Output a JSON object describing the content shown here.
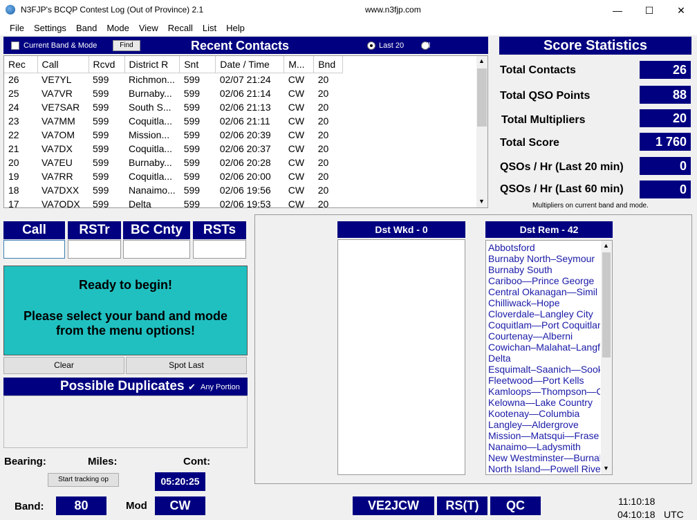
{
  "window": {
    "title": "N3FJP's BCQP Contest Log (Out of Province) 2.1",
    "url": "www.n3fjp.com",
    "minimize": "—",
    "maximize": "☐",
    "close": "✕"
  },
  "menu": [
    "File",
    "Settings",
    "Band",
    "Mode",
    "View",
    "Recall",
    "List",
    "Help"
  ],
  "recent_contacts": {
    "title": "Recent Contacts",
    "filter_label": "Current Band & Mode",
    "find_label": "Find",
    "radio_last20": "Last 20",
    "radio_all": "All",
    "columns": [
      "Rec",
      "Call",
      "Rcvd",
      "District R",
      "Snt",
      "Date / Time",
      "M...",
      "Bnd"
    ],
    "rows": [
      [
        "26",
        "VE7YL",
        "599",
        "Richmon...",
        "599",
        "02/07  21:24",
        "CW",
        "20"
      ],
      [
        "25",
        "VA7VR",
        "599",
        "Burnaby...",
        "599",
        "02/06  21:14",
        "CW",
        "20"
      ],
      [
        "24",
        "VE7SAR",
        "599",
        "South S...",
        "599",
        "02/06  21:13",
        "CW",
        "20"
      ],
      [
        "23",
        "VA7MM",
        "599",
        "Coquitla...",
        "599",
        "02/06  21:11",
        "CW",
        "20"
      ],
      [
        "22",
        "VA7OM",
        "599",
        "Mission...",
        "599",
        "02/06  20:39",
        "CW",
        "20"
      ],
      [
        "21",
        "VA7DX",
        "599",
        "Coquitla...",
        "599",
        "02/06  20:37",
        "CW",
        "20"
      ],
      [
        "20",
        "VA7EU",
        "599",
        "Burnaby...",
        "599",
        "02/06  20:28",
        "CW",
        "20"
      ],
      [
        "19",
        "VA7RR",
        "599",
        "Coquitla...",
        "599",
        "02/06  20:00",
        "CW",
        "20"
      ],
      [
        "18",
        "VA7DXX",
        "599",
        "Nanaimo...",
        "599",
        "02/06  19:56",
        "CW",
        "20"
      ],
      [
        "17",
        "VA7QDX",
        "599",
        "Delta",
        "599",
        "02/06  19:53",
        "CW",
        "20"
      ]
    ]
  },
  "score": {
    "title": "Score Statistics",
    "total_contacts_label": "Total Contacts",
    "total_contacts": "26",
    "total_qso_points_label": "Total QSO Points",
    "total_qso_points": "88",
    "total_multipliers_label": "Total Multipliers",
    "total_multipliers": "20",
    "total_score_label": "Total Score",
    "total_score": "1 760",
    "qso_hr20_label": "QSOs / Hr (Last 20 min)",
    "qso_hr20": "0",
    "qso_hr60_label": "QSOs / Hr (Last 60 min)",
    "qso_hr60": "0",
    "note": "Multipliers on current band and mode."
  },
  "entry": {
    "call_label": "Call",
    "rstr_label": "RSTr",
    "bccnty_label": "BC Cnty",
    "rsts_label": "RSTs"
  },
  "message": {
    "line1": "Ready to begin!",
    "line2": "Please select your band and mode",
    "line3": "from the menu options!"
  },
  "buttons": {
    "clear": "Clear",
    "spot_last": "Spot Last",
    "start_tracking": "Start tracking op"
  },
  "duplicates": {
    "title": "Possible Duplicates",
    "any_portion": "Any Portion"
  },
  "bottom": {
    "bearing_label": "Bearing:",
    "miles_label": "Miles:",
    "cont_label": "Cont:",
    "timer": "05:20:25",
    "band_label": "Band:",
    "band": "80",
    "mode_label": "Mod",
    "mode": "CW",
    "operator": "VE2JCW",
    "rst": "RS(T)",
    "province": "QC",
    "local_time": "11:10:18",
    "utc_time": "04:10:18",
    "utc_label": "UTC"
  },
  "districts": {
    "worked_header": "Dst Wkd - 0",
    "remaining_header": "Dst Rem - 42",
    "remaining": [
      "Abbotsford",
      "Burnaby North–Seymour",
      "Burnaby South",
      "Cariboo—Prince George",
      "Central Okanagan—Simil",
      "Chilliwack–Hope",
      "Cloverdale–Langley City",
      "Coquitlam—Port Coquitlan",
      "Courtenay—Alberni",
      "Cowichan–Malahat–Langf",
      "Delta",
      "Esquimalt–Saanich—Sook",
      "Fleetwood—Port Kells",
      "Kamloops—Thompson—C",
      "Kelowna—Lake Country",
      "Kootenay—Columbia",
      "Langley—Aldergrove",
      "Mission—Matsqui—Frase",
      "Nanaimo—Ladysmith",
      "New Westminster—Burnal",
      "North Island—Powell Rive"
    ]
  }
}
